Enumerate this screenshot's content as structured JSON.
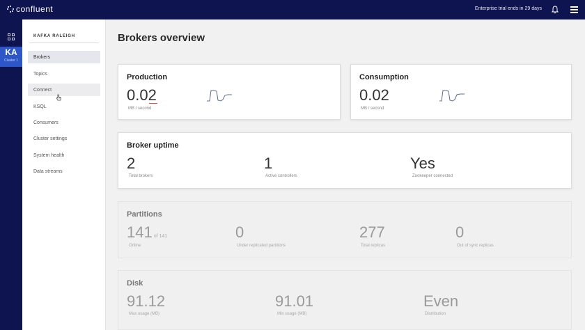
{
  "app": {
    "brand": "confluent",
    "trial_notice": "Enterprise trial ends in 29 days"
  },
  "rail": {
    "cluster_abbr": "KA",
    "cluster_sub": "Cluster 1"
  },
  "sidebar": {
    "cluster_name": "KAFKA RALEIGH",
    "items": [
      {
        "label": "Brokers"
      },
      {
        "label": "Topics"
      },
      {
        "label": "Connect"
      },
      {
        "label": "KSQL"
      },
      {
        "label": "Consumers"
      },
      {
        "label": "Cluster settings"
      },
      {
        "label": "System health"
      },
      {
        "label": "Data streams"
      }
    ]
  },
  "main": {
    "title": "Brokers overview",
    "production": {
      "title": "Production",
      "value": "0.02",
      "unit": "MB / second"
    },
    "consumption": {
      "title": "Consumption",
      "value": "0.02",
      "unit": "MB / second"
    },
    "uptime": {
      "title": "Broker uptime",
      "total_brokers": "2",
      "total_brokers_label": "Total brokers",
      "active_controllers": "1",
      "active_controllers_label": "Active controllers",
      "zookeeper": "Yes",
      "zookeeper_label": "Zookeeper connected"
    },
    "partitions": {
      "title": "Partitions",
      "online": "141",
      "online_of": "of 141",
      "online_label": "Online",
      "under_replicated": "0",
      "under_replicated_label": "Under replicated partitions",
      "total_replicas": "277",
      "total_replicas_label": "Total replicas",
      "out_of_sync": "0",
      "out_of_sync_label": "Out of sync replicas"
    },
    "disk": {
      "title": "Disk",
      "max_usage": "91.12",
      "max_usage_label": "Max usage (MB)",
      "min_usage": "91.01",
      "min_usage_label": "Min usage (MB)",
      "distribution": "Even",
      "distribution_label": "Distribution"
    }
  },
  "colors": {
    "topbar": "#0d1450",
    "cluster_tile": "#2d57c8",
    "sparkline": "#5a6b8c"
  }
}
